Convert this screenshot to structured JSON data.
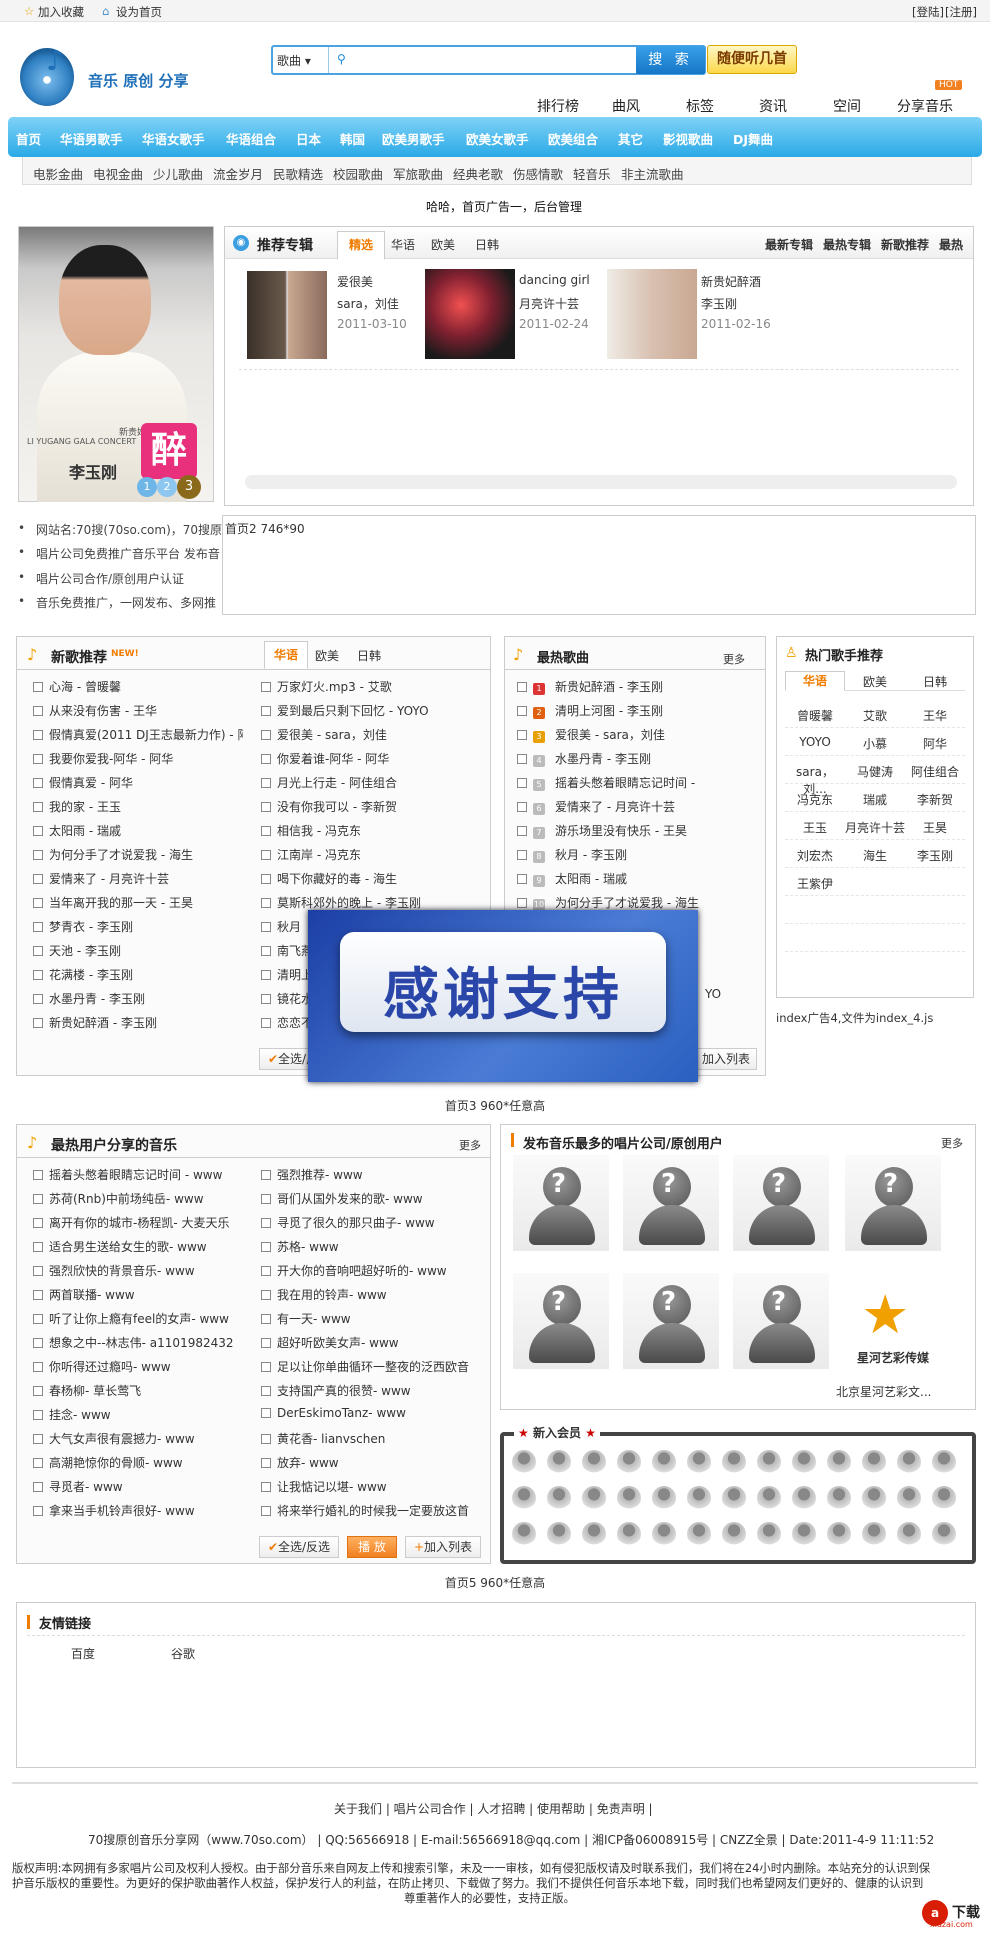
{
  "topbar": {
    "fav": "加入收藏",
    "home": "设为首页",
    "login": "[登陆]",
    "register": "[注册]"
  },
  "logo": {
    "text": "音乐 原创 分享"
  },
  "search": {
    "category": "歌曲",
    "button": "搜 索",
    "random": "随便听几首"
  },
  "subnav": [
    "排行榜",
    "曲风",
    "标签",
    "资讯",
    "空间",
    "分享音乐"
  ],
  "hot_badge": "HOT",
  "mainnav": [
    "首页",
    "华语男歌手",
    "华语女歌手",
    "华语组合",
    "日本",
    "韩国",
    "欧美男歌手",
    "欧美女歌手",
    "欧美组合",
    "其它",
    "影视歌曲",
    "DJ舞曲"
  ],
  "catbar": [
    "电影金曲",
    "电视金曲",
    "少儿歌曲",
    "流金岁月",
    "民歌精选",
    "校园歌曲",
    "军旅歌曲",
    "经典老歌",
    "伤感情歌",
    "轻音乐",
    "非主流歌曲"
  ],
  "ad1": "哈哈，首页广告一，后台管理",
  "photo": {
    "title": "李玉刚",
    "dots": [
      "1",
      "2",
      "3"
    ],
    "caption": "LI YUGANG GALA CONCERT",
    "subcaption": "新贵妃醉酒"
  },
  "rec": {
    "title": "推荐专辑",
    "tabs": [
      "精选",
      "华语",
      "欧美",
      "日韩"
    ],
    "links": [
      "最新专辑",
      "最热专辑",
      "新歌推荐",
      "最热"
    ],
    "albums": [
      {
        "name": "爱很美",
        "artist": "sara，刘佳",
        "date": "2011-03-10"
      },
      {
        "name": "dancing girl",
        "artist": "月亮许十芸",
        "date": "2011-02-24"
      },
      {
        "name": "新贵妃醉酒",
        "artist": "李玉刚",
        "date": "2011-02-16"
      }
    ]
  },
  "info": [
    "网站名:70搜(70so.com)，70搜原",
    "唱片公司免费推广音乐平台 发布音",
    "唱片公司合作/原创用户认证",
    "音乐免费推广，一网发布、多网推"
  ],
  "ad2": "首页2 746*90",
  "newsongs": {
    "title": "新歌推荐",
    "new": "NEW!",
    "tabs": [
      "华语",
      "欧美",
      "日韩"
    ],
    "left": [
      "心海 - 曾暖馨",
      "从来没有伤害 - 王华",
      "假情真爱(2011 DJ王志最新力作) - 阿",
      "我要你爱我-阿华 - 阿华",
      "假情真爱 - 阿华",
      "我的家 - 王玉",
      "太阳雨 - 瑞戚",
      "为何分手了才说爱我 - 海生",
      "爱情来了 - 月亮许十芸",
      "当年离开我的那一天 - 王昊",
      "梦青衣 - 李玉刚",
      "天池 - 李玉刚",
      "花满楼 - 李玉刚",
      "水墨丹青 - 李玉刚",
      "新贵妃醉酒 - 李玉刚"
    ],
    "right": [
      "万家灯火.mp3 - 艾歌",
      "爱到最后只剩下回忆 - YOYO",
      "爱很美 - sara，刘佳",
      "你爱着谁-阿华 - 阿华",
      "月光上行走 - 阿佳组合",
      "没有你我可以 - 李新贺",
      "相信我 - 冯克东",
      "江南岸 - 冯克东",
      "喝下你藏好的毒 - 海生",
      "莫斯科郊外的晚上 - 李玉刚",
      "秋月",
      "南飞燕",
      "清明上",
      "镜花水",
      "恋恋不"
    ],
    "btn_select": "全选/反选"
  },
  "hotsongs": {
    "title": "最热歌曲",
    "more": "更多",
    "items": [
      "新贵妃醉酒 - 李玉刚",
      "清明上河图 - 李玉刚",
      "爱很美 - sara，刘佳",
      "水墨丹青 - 李玉刚",
      "摇着头憋着眼睛忘记时间 -",
      "爱情来了 - 月亮许十芸",
      "游乐场里没有快乐 - 王昊",
      "秋月 - 李玉刚",
      "太阳雨 - 瑞戚",
      "为何分手了才说爱我 - 海生"
    ],
    "partial": "YO",
    "btn_add": "加入列表"
  },
  "singers": {
    "title": "热门歌手推荐",
    "tabs": [
      "华语",
      "欧美",
      "日韩"
    ],
    "names": [
      "曾暖馨",
      "艾歌",
      "王华",
      "YOYO",
      "小慕",
      "阿华",
      "sara，刘...",
      "马健涛",
      "阿佳组合",
      "冯克东",
      "瑞戚",
      "李新贺",
      "王玉",
      "月亮许十芸",
      "王昊",
      "刘宏杰",
      "海生",
      "李玉刚",
      "王紫伊"
    ]
  },
  "ad4": "index广告4,文件为index_4.js",
  "ad3": "首页3 960*任意高",
  "thanks": "感谢支持",
  "shared": {
    "title": "最热用户分享的音乐",
    "more": "更多",
    "left": [
      "摇着头憋着眼睛忘记时间 - www",
      "苏荷(Rnb)中前场纯岳- www",
      "离开有你的城市-杨程凯- 大麦天乐",
      "适合男生送给女生的歌- www",
      "强烈欣快的背景音乐- www",
      "两首联播- www",
      "听了让你上瘾有feel的女声- www",
      "想象之中--林志伟- a1101982432",
      "你听得还过瘾吗- www",
      "春杨柳- 草长莺飞",
      "挂念- www",
      "大气女声很有震撼力- www",
      "高潮艳惊你的骨顺- www",
      "寻觅者- www",
      "拿来当手机铃声很好- www"
    ],
    "right": [
      "强烈推荐- www",
      "哥们从国外发来的歌- www",
      "寻觅了很久的那只曲子- www",
      "苏格- www",
      "开大你的音响吧超好听的- www",
      "我在用的铃声- www",
      "有一天- www",
      "超好听欧美女声- www",
      "足以让你单曲循环一整夜的泛西欧音",
      "支持国产真的很赞- www",
      "DerEskimoTanz- www",
      "黄花香- lianvschen",
      "放弃- www",
      "让我惦记以堪- www",
      "将来举行婚礼的时候我一定要放这首"
    ],
    "btn_select": "全选/反选",
    "btn_play": "播 放",
    "btn_add": "加入列表"
  },
  "labels": {
    "title": "发布音乐最多的唱片公司/原创用户",
    "more": "更多",
    "star_name": "星河艺彩传媒",
    "star_caption": "北京星河艺彩文..."
  },
  "members": {
    "title": "新入会员"
  },
  "ad5": "首页5 960*任意高",
  "links": {
    "title": "友情链接",
    "items": [
      "百度",
      "谷歌"
    ]
  },
  "footer": {
    "nav": "关于我们 | 唱片公司合作 | 人才招聘 | 使用帮助 | 免责声明 |",
    "info": "70搜原创音乐分享网（www.70so.com） | QQ:56566918 | E-mail:56566918@qq.com | 湘ICP备06008915号 | CNZZ全景 | Date:2011-4-9 11:11:52",
    "disclaimer1": "版权声明:本网拥有多家唱片公司及权利人授权。由于部分音乐来自网友上传和搜索引擎，未及一一审核，如有侵犯版权请及时联系我们，我们将在24小时内删除。本站充分的认识到保",
    "disclaimer2": "护音乐版权的重要性。为更好的保护歌曲著作人权益，保护发行人的利益，在防止拷贝、下载做了努力。我们不提供任何音乐本地下载，同时我们也希望网友们更好的、健康的认识到",
    "disclaimer3": "尊重著作人的必要性，支持正版。"
  },
  "watermark": "下载",
  "watermark_url": "xiazai.com",
  "colors": {
    "accent": "#f07c00",
    "nav": "#2aaae6",
    "brand": "#1e6fb8"
  }
}
